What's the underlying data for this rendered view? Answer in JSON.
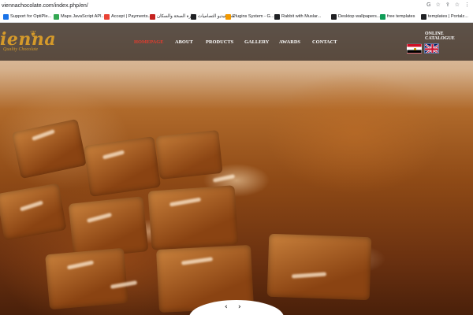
{
  "browser": {
    "url": "viennachocolate.com/index.php/en/",
    "url_icons": [
      "G",
      "☆",
      "⇪",
      "☆",
      "⋮"
    ],
    "bookmarks": [
      {
        "label": "Support for OptiPle...",
        "color": "#1a73e8"
      },
      {
        "label": "Maps JavaScript API...",
        "color": "#34a853"
      },
      {
        "label": "Accept | Payments...",
        "color": "#ea4335"
      },
      {
        "label": "وزارة الصحة والسكان",
        "color": "#c5221f"
      },
      {
        "label": "بنت فيديو التصاميات",
        "color": "#202124"
      },
      {
        "label": "Plugins System - G...",
        "color": "#f29900"
      },
      {
        "label": "Rabbit with Muslar...",
        "color": "#202124"
      },
      {
        "label": "Desktop wallpapers...",
        "color": "#202124"
      },
      {
        "label": "free templates",
        "color": "#0f9d58"
      },
      {
        "label": "templates | Portalz...",
        "color": "#202124"
      }
    ]
  },
  "site": {
    "logo": {
      "word": "ienna",
      "subtitle": "Quality Chocolate"
    },
    "menu": [
      {
        "label": "HOMEPAGE",
        "active": true
      },
      {
        "label": "ABOUT",
        "active": false
      },
      {
        "label": "PRODUCTS",
        "active": false
      },
      {
        "label": "GALLERY",
        "active": false
      },
      {
        "label": "AWARDS",
        "active": false
      },
      {
        "label": "CONTACT",
        "active": false
      }
    ],
    "catalogue_label": "ONLINE CATALOGUE",
    "languages": [
      "Arabic",
      "English"
    ],
    "slider": {
      "prev": "‹",
      "next": "›"
    }
  },
  "colors": {
    "accent": "#d59a2a",
    "active_menu": "#e53c2e"
  }
}
